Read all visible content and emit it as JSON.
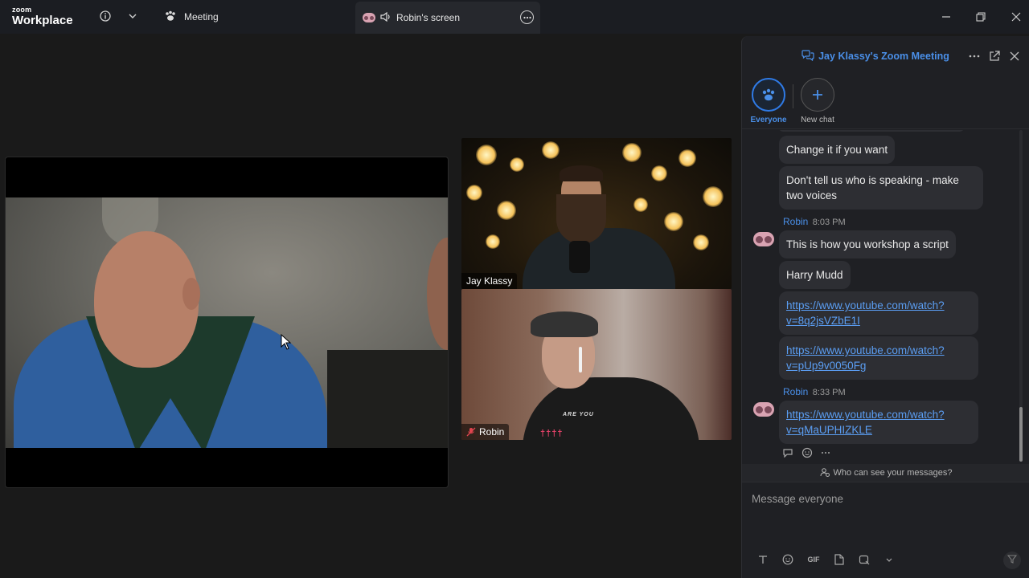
{
  "app": {
    "logo_top": "zoom",
    "logo_bottom": "Workplace",
    "meeting_label": "Meeting",
    "screen_tab_label": "Robin's screen"
  },
  "video": {
    "tiles": [
      {
        "name": "Jay Klassy"
      },
      {
        "name": "Robin"
      }
    ],
    "robin_shirt_text": "ARE YOU",
    "robin_shirt_logo": "††††"
  },
  "chat": {
    "title": "Jay Klassy's Zoom Meeting",
    "recipients": {
      "everyone_label": "Everyone",
      "new_chat_label": "New chat"
    },
    "messages": [
      {
        "text": "Change it if you want"
      },
      {
        "text": "Don't tell us who is speaking - make two voices"
      },
      {
        "sender": "Robin",
        "time": "8:03 PM",
        "text": "This is how you workshop a script"
      },
      {
        "text": "Harry Mudd"
      },
      {
        "link": "https://www.youtube.com/watch?v=8q2jsVZbE1I"
      },
      {
        "link": "https://www.youtube.com/watch?v=pUp9v0050Fg"
      },
      {
        "sender": "Robin",
        "time": "8:33 PM",
        "link": "https://www.youtube.com/watch?v=qMaUPHIZKLE"
      }
    ],
    "who_can_see": "Who can see your messages?",
    "compose_placeholder": "Message everyone",
    "gif_label": "GIF"
  },
  "colors": {
    "accent": "#4a8fe8",
    "link": "#5b9ef3",
    "bubble": "#2d2e33",
    "panel": "#1f2024"
  }
}
